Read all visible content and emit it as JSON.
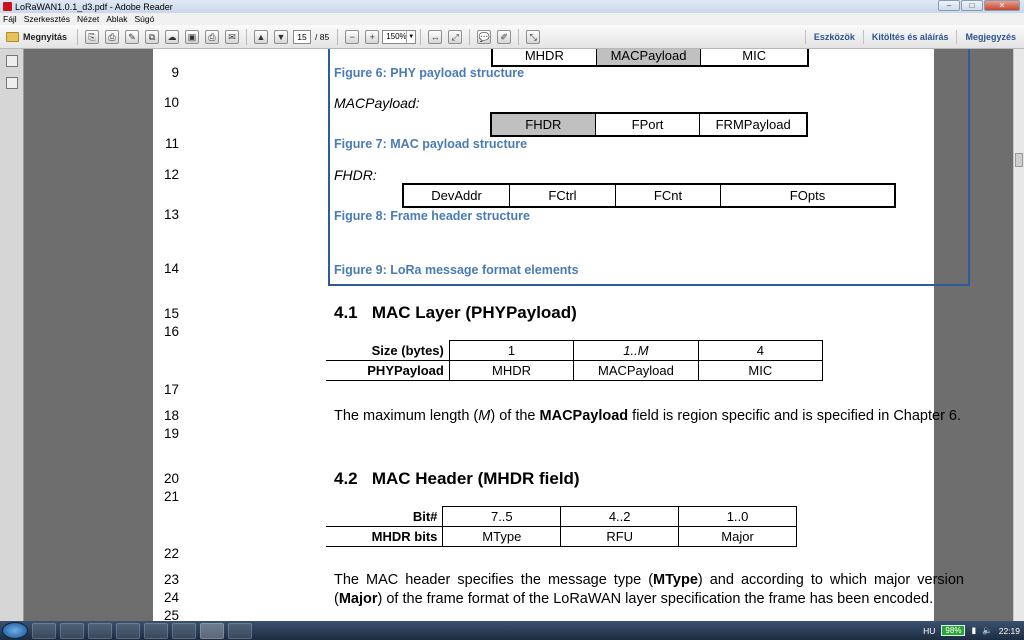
{
  "window": {
    "title": "LoRaWAN1.0.1_d3.pdf - Adobe Reader"
  },
  "menu": [
    "Fájl",
    "Szerkesztés",
    "Nézet",
    "Ablak",
    "Súgó"
  ],
  "toolbar": {
    "open_label": "Megnyitás",
    "page_current": "15",
    "page_total": "/ 85",
    "zoom": "150%",
    "right": [
      "Eszközök",
      "Kitöltés és aláírás",
      "Megjegyzés"
    ]
  },
  "document": {
    "line_numbers": [
      "9",
      "10",
      "11",
      "12",
      "13",
      "14",
      "15",
      "16",
      "17",
      "18",
      "19",
      "20",
      "21",
      "22",
      "23",
      "24",
      "25"
    ],
    "fig6": {
      "cells": [
        "MHDR",
        "MACPayload",
        "MIC"
      ],
      "caption": "Figure 6: PHY payload structure"
    },
    "fig7": {
      "label": "MACPayload:",
      "cells": [
        "FHDR",
        "FPort",
        "FRMPayload"
      ],
      "caption": "Figure 7: MAC payload structure"
    },
    "fig8": {
      "label": "FHDR:",
      "cells": [
        "DevAddr",
        "FCtrl",
        "FCnt",
        "FOpts"
      ],
      "caption": "Figure 8: Frame header structure"
    },
    "fig9": {
      "caption": "Figure 9: LoRa message format elements"
    },
    "sec41": {
      "num": "4.1",
      "title": "MAC Layer (PHYPayload)"
    },
    "table1": {
      "row1_label": "Size (bytes)",
      "row1": [
        "1",
        "1..M",
        "4"
      ],
      "row2_label": "PHYPayload",
      "row2": [
        "MHDR",
        "MACPayload",
        "MIC"
      ]
    },
    "para1": {
      "a": "The maximum length (",
      "m": "M",
      "b": ") of the ",
      "bold": "MACPayload",
      "c": " field is region specific and is specified in Chapter 6."
    },
    "sec42": {
      "num": "4.2",
      "title": "MAC Header (MHDR field)"
    },
    "table2": {
      "row1_label": "Bit#",
      "row1": [
        "7..5",
        "4..2",
        "1..0"
      ],
      "row2_label": "MHDR bits",
      "row2": [
        "MType",
        "RFU",
        "Major"
      ]
    },
    "para2": {
      "a": "The MAC header specifies the message type (",
      "b1": "MType",
      "b": ") and according to which major version (",
      "b2": "Major",
      "c": ") of the frame format of the LoRaWAN layer specification the frame has been encoded."
    }
  },
  "tray": {
    "lang": "HU",
    "battery": "98%",
    "time": "22:19"
  }
}
